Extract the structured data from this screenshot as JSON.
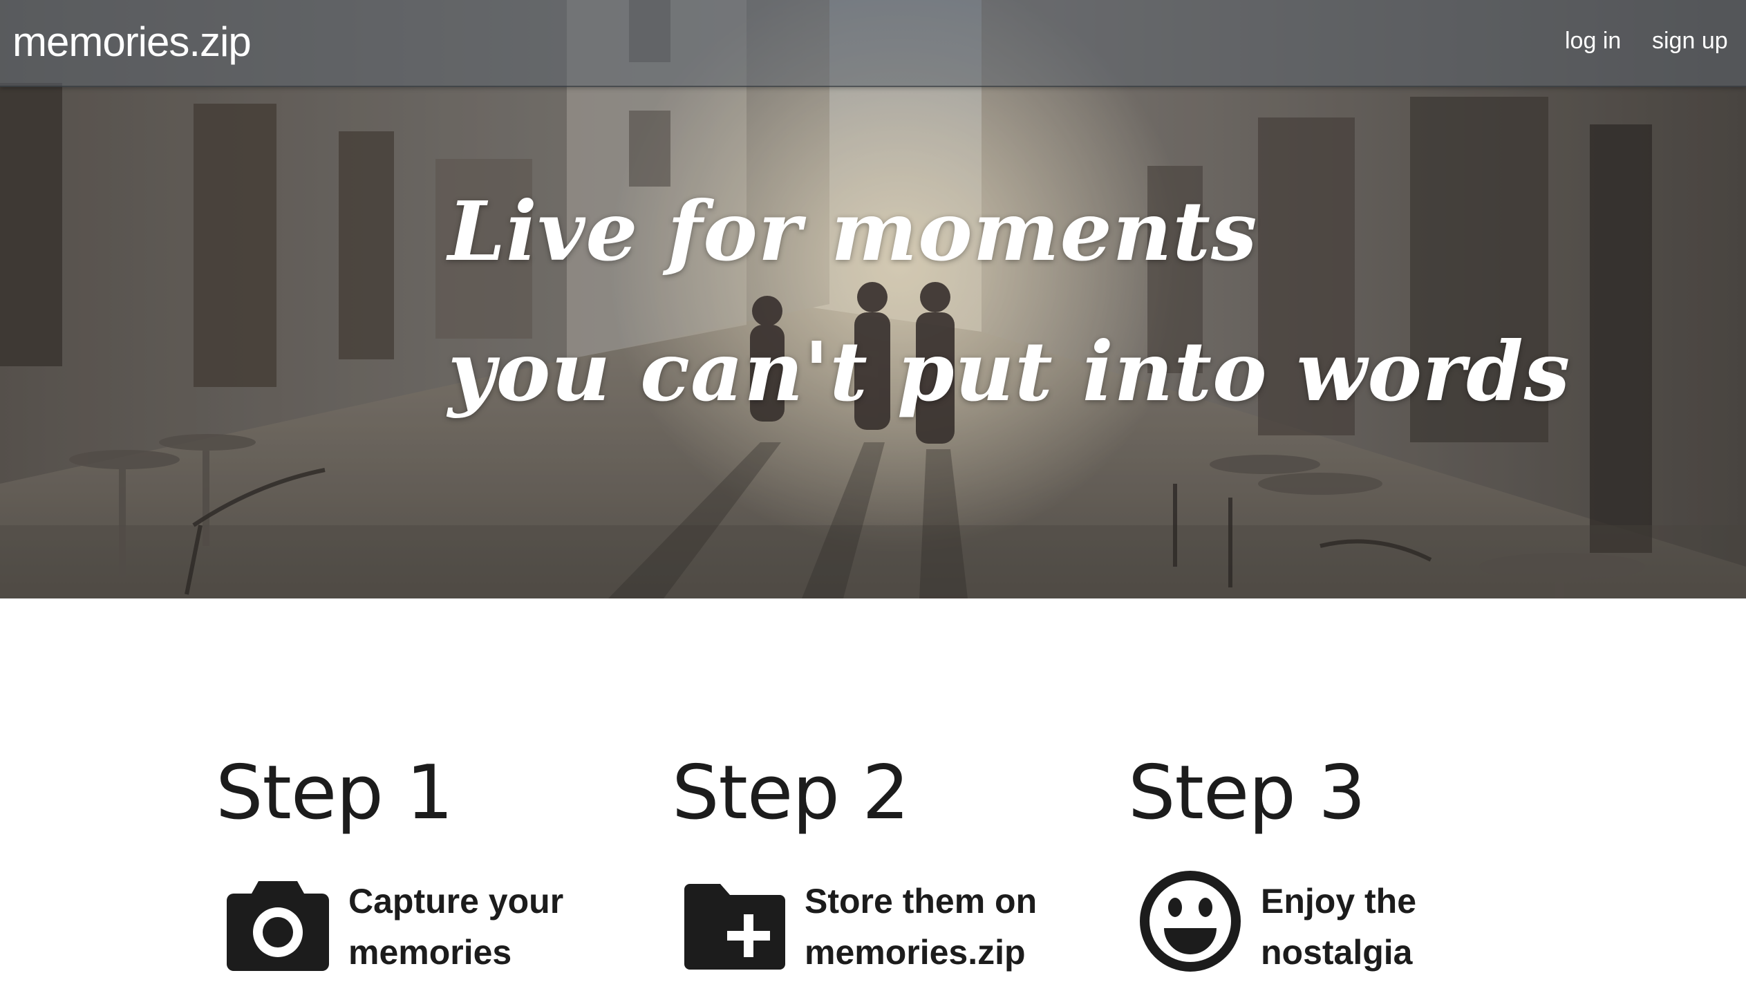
{
  "nav": {
    "brand": "memories.zip",
    "login_label": "log in",
    "signup_label": "sign up"
  },
  "hero": {
    "tagline_line1": "Live for moments",
    "tagline_line2": "you can't put into words"
  },
  "steps": [
    {
      "title": "Step 1",
      "icon": "camera-icon",
      "text": "Capture your memories"
    },
    {
      "title": "Step 2",
      "icon": "folder-plus-icon",
      "text": "Store them on memories.zip"
    },
    {
      "title": "Step 3",
      "icon": "smiley-icon",
      "text": "Enjoy the nostalgia"
    }
  ],
  "colors": {
    "nav_overlay": "#5c646e",
    "text_dark": "#1c1c1c",
    "white": "#ffffff"
  }
}
